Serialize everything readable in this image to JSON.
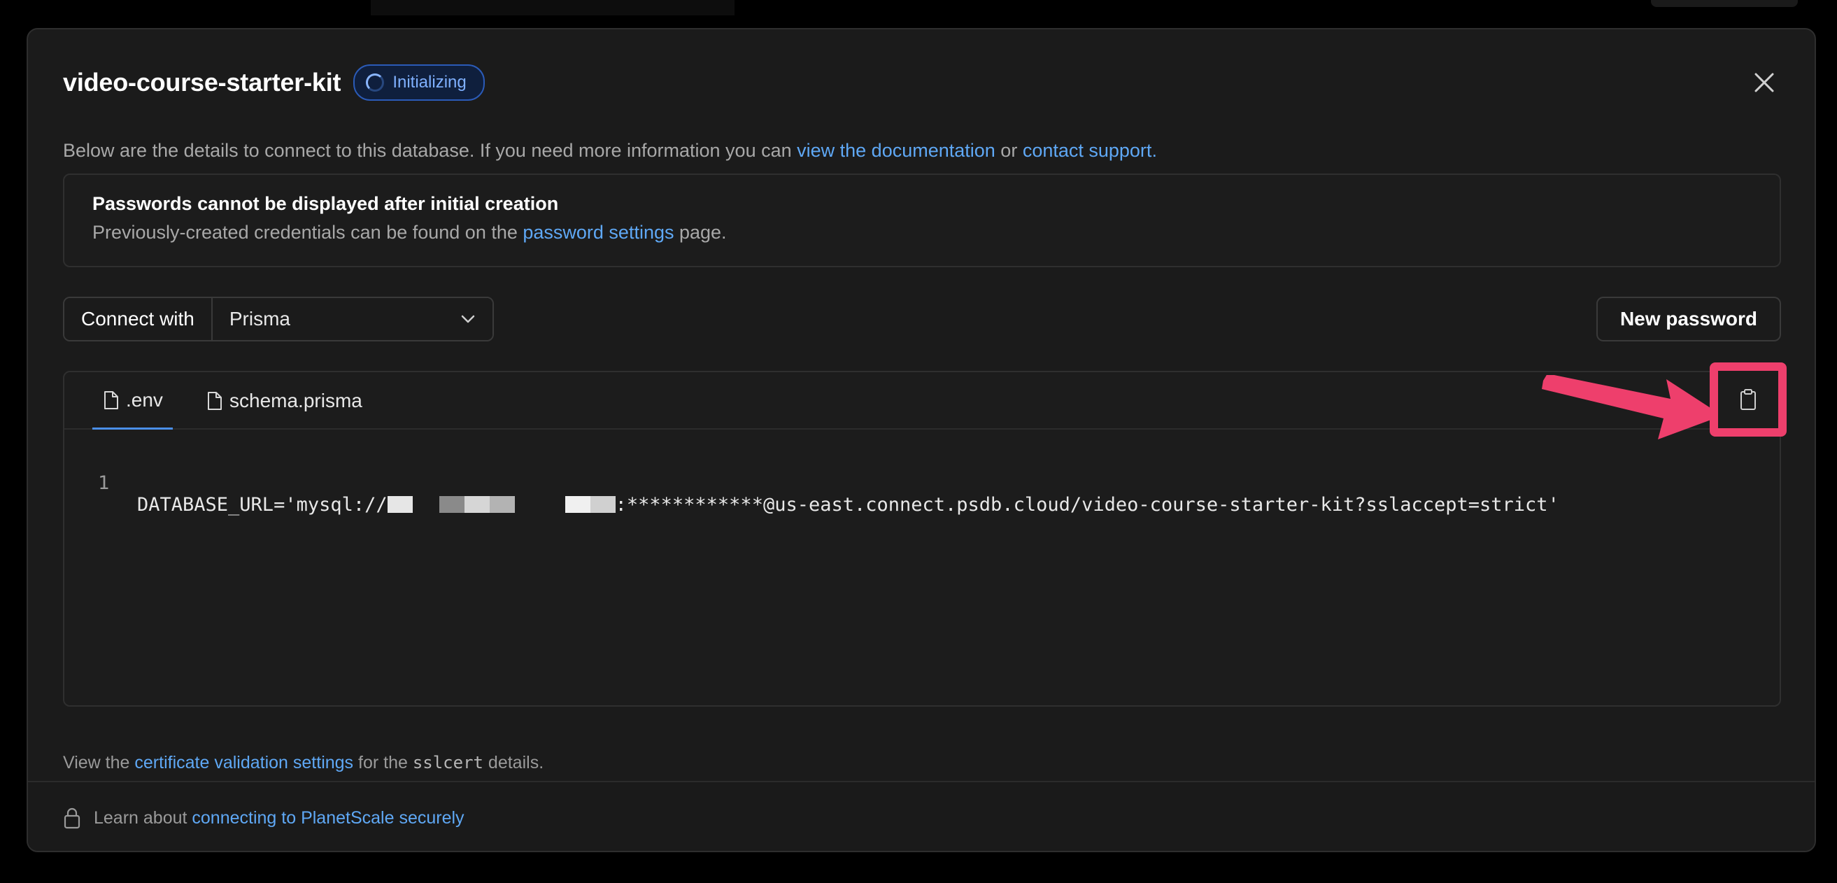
{
  "dialog": {
    "title": "video-course-starter-kit",
    "status": "Initializing",
    "subtitle_prefix": "Below are the details to connect to this database. If you need more information you can ",
    "docs_link": "view the documentation",
    "subtitle_or": " or ",
    "support_link": "contact support",
    "subtitle_suffix": "."
  },
  "notice": {
    "title": "Passwords cannot be displayed after initial creation",
    "body_prefix": "Previously-created credentials can be found on the ",
    "link": "password settings",
    "body_suffix": " page."
  },
  "connect": {
    "label": "Connect with",
    "selected": "Prisma"
  },
  "new_password_label": "New password",
  "tabs": [
    {
      "label": ".env",
      "active": true
    },
    {
      "label": "schema.prisma",
      "active": false
    }
  ],
  "code": {
    "line_number": "1",
    "prefix": "DATABASE_URL='mysql://",
    "suffix": ":************@us-east.connect.psdb.cloud/video-course-starter-kit?sslaccept=strict'"
  },
  "footnote": {
    "prefix": "View the ",
    "link": "certificate validation settings",
    "middle": " for the ",
    "code": "sslcert",
    "suffix": " details."
  },
  "footer": {
    "prefix": "Learn about ",
    "link": "connecting to PlanetScale securely"
  },
  "icons": {
    "close": "close-icon",
    "spinner": "spinner-icon",
    "chevron": "chevron-down-icon",
    "file": "file-icon",
    "copy": "clipboard-icon",
    "lock": "lock-icon",
    "arrow": "annotation-arrow"
  },
  "colors": {
    "accent_link": "#5fa8f5",
    "highlight": "#ee3f6c",
    "badge_border": "#2b5bb8"
  }
}
